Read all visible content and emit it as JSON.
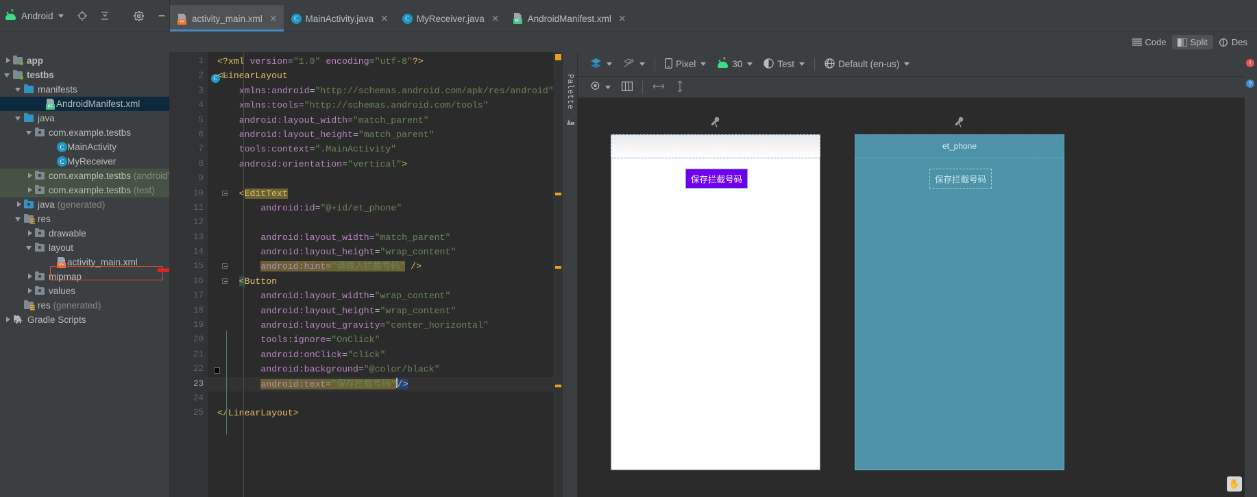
{
  "window": {
    "project_selector": "Android",
    "icons": [
      "android-icon",
      "locate-icon",
      "collapse-all-icon",
      "settings-icon",
      "minimize-icon"
    ]
  },
  "tabs": [
    {
      "label": "activity_main.xml",
      "icon": "xml-layout-icon",
      "active": true,
      "closable": true
    },
    {
      "label": "MainActivity.java",
      "icon": "java-class-icon",
      "active": false,
      "closable": true
    },
    {
      "label": "MyReceiver.java",
      "icon": "java-class-icon",
      "active": false,
      "closable": true
    },
    {
      "label": "AndroidManifest.xml",
      "icon": "manifest-icon",
      "active": false,
      "closable": true
    }
  ],
  "view_modes": [
    {
      "label": "Code",
      "icon": "code-icon",
      "selected": false
    },
    {
      "label": "Split",
      "icon": "split-icon",
      "selected": true
    },
    {
      "label": "Des",
      "icon": "design-icon",
      "selected": false
    }
  ],
  "project_tree": [
    {
      "label": "app",
      "indent": 0,
      "arrow": "right",
      "icon": "module-folder",
      "bold": true,
      "state": "none"
    },
    {
      "label": "testbs",
      "indent": 0,
      "arrow": "down",
      "icon": "module-folder",
      "bold": true,
      "state": "none"
    },
    {
      "label": "manifests",
      "indent": 1,
      "arrow": "down",
      "icon": "folder-blue",
      "bold": false,
      "state": "none"
    },
    {
      "label": "AndroidManifest.xml",
      "indent": 3,
      "arrow": "none",
      "icon": "manifest-icon",
      "bold": false,
      "state": "selected"
    },
    {
      "label": "java",
      "indent": 1,
      "arrow": "down",
      "icon": "folder-blue",
      "bold": false,
      "state": "none"
    },
    {
      "label": "com.example.testbs",
      "indent": 2,
      "arrow": "down",
      "icon": "package",
      "bold": false,
      "state": "none"
    },
    {
      "label": "MainActivity",
      "indent": 4,
      "arrow": "none",
      "icon": "class-icon",
      "bold": false,
      "state": "none"
    },
    {
      "label": "MyReceiver",
      "indent": 4,
      "arrow": "none",
      "icon": "class-icon",
      "bold": false,
      "state": "none"
    },
    {
      "label": "com.example.testbs",
      "suffix": " (androidTest)",
      "indent": 2,
      "arrow": "right",
      "icon": "package",
      "bold": false,
      "state": "group"
    },
    {
      "label": "com.example.testbs",
      "suffix": " (test)",
      "indent": 2,
      "arrow": "right",
      "icon": "package",
      "bold": false,
      "state": "group"
    },
    {
      "label": "java",
      "suffix": " (generated)",
      "indent": 1,
      "arrow": "right",
      "icon": "folder-gen",
      "bold": false,
      "state": "none"
    },
    {
      "label": "res",
      "indent": 1,
      "arrow": "down",
      "icon": "folder-res",
      "bold": false,
      "state": "none"
    },
    {
      "label": "drawable",
      "indent": 2,
      "arrow": "right",
      "icon": "package",
      "bold": false,
      "state": "none"
    },
    {
      "label": "layout",
      "indent": 2,
      "arrow": "down",
      "icon": "package",
      "bold": false,
      "state": "none"
    },
    {
      "label": "activity_main.xml",
      "indent": 4,
      "arrow": "none",
      "icon": "xml-layout-icon",
      "bold": false,
      "state": "highlighted"
    },
    {
      "label": "mipmap",
      "indent": 2,
      "arrow": "right",
      "icon": "package",
      "bold": false,
      "state": "none"
    },
    {
      "label": "values",
      "indent": 2,
      "arrow": "right",
      "icon": "package",
      "bold": false,
      "state": "none"
    },
    {
      "label": "res",
      "suffix": " (generated)",
      "indent": 1,
      "arrow": "none",
      "icon": "folder-res",
      "bold": false,
      "state": "none"
    },
    {
      "label": "Gradle Scripts",
      "indent": 0,
      "arrow": "right",
      "icon": "gradle-icon",
      "bold": false,
      "state": "none"
    }
  ],
  "editor": {
    "file": "activity_main.xml",
    "cursor_line": 23,
    "lines": [
      {
        "n": 1,
        "text": "<?xml version=\"1.0\" encoding=\"utf-8\"?>"
      },
      {
        "n": 2,
        "text": "<LinearLayout"
      },
      {
        "n": 3,
        "text": "    xmlns:android=\"http://schemas.android.com/apk/res/android\""
      },
      {
        "n": 4,
        "text": "    xmlns:tools=\"http://schemas.android.com/tools\""
      },
      {
        "n": 5,
        "text": "    android:layout_width=\"match_parent\""
      },
      {
        "n": 6,
        "text": "    android:layout_height=\"match_parent\""
      },
      {
        "n": 7,
        "text": "    tools:context=\".MainActivity\""
      },
      {
        "n": 8,
        "text": "    android:orientation=\"vertical\">"
      },
      {
        "n": 9,
        "text": ""
      },
      {
        "n": 10,
        "text": "    <EditText"
      },
      {
        "n": 11,
        "text": "        android:id=\"@+id/et_phone\""
      },
      {
        "n": 12,
        "text": ""
      },
      {
        "n": 13,
        "text": "        android:layout_width=\"match_parent\""
      },
      {
        "n": 14,
        "text": "        android:layout_height=\"wrap_content\""
      },
      {
        "n": 15,
        "text": "        android:hint=\"请输入拦截号码\" />"
      },
      {
        "n": 16,
        "text": "    <Button"
      },
      {
        "n": 17,
        "text": "        android:layout_width=\"wrap_content\""
      },
      {
        "n": 18,
        "text": "        android:layout_height=\"wrap_content\""
      },
      {
        "n": 19,
        "text": "        android:layout_gravity=\"center_horizontal\""
      },
      {
        "n": 20,
        "text": "        tools:ignore=\"OnClick\""
      },
      {
        "n": 21,
        "text": "        android:onClick=\"click\""
      },
      {
        "n": 22,
        "text": "        android:background=\"@color/black\""
      },
      {
        "n": 23,
        "text": "        android:text=\"保存拦截号码\" />"
      },
      {
        "n": 24,
        "text": ""
      },
      {
        "n": 25,
        "text": "</LinearLayout>"
      }
    ]
  },
  "design_toolbar": {
    "row1": [
      {
        "label": "",
        "icon": "design-surface-icon"
      },
      {
        "label": "",
        "icon": "blueprint-off-icon"
      },
      {
        "label": "Pixel",
        "icon": "device-icon",
        "dropdown": true
      },
      {
        "label": "30",
        "icon": "api-android-icon",
        "dropdown": true
      },
      {
        "label": "Test",
        "icon": "theme-icon",
        "dropdown": true
      },
      {
        "label": "Default (en-us)",
        "icon": "locale-icon",
        "dropdown": true
      }
    ],
    "row2": [
      {
        "label": "",
        "icon": "eye-icon"
      },
      {
        "label": "",
        "icon": "columns-icon"
      },
      {
        "label": "",
        "icon": "horizontal-resize-icon"
      },
      {
        "label": "",
        "icon": "vertical-resize-icon"
      }
    ]
  },
  "palette": {
    "label": "Palette",
    "component_tree_icon": "component-tree-icon"
  },
  "preview": {
    "design_button_label": "保存拦截号码",
    "blueprint_hint_label": "et_phone",
    "blueprint_button_label": "保存拦截号码",
    "wrench_icon": "wrench-icon"
  },
  "status_icons": {
    "error_badge": "!",
    "help_badge": "?"
  },
  "colors": {
    "accent_blue": "#4a88c7",
    "android_green": "#3ddc84",
    "selection_navy": "#0d293e",
    "highlight_red": "#ef4b38",
    "button_purple": "#7000ec",
    "blueprint_teal": "#4f93a8"
  }
}
